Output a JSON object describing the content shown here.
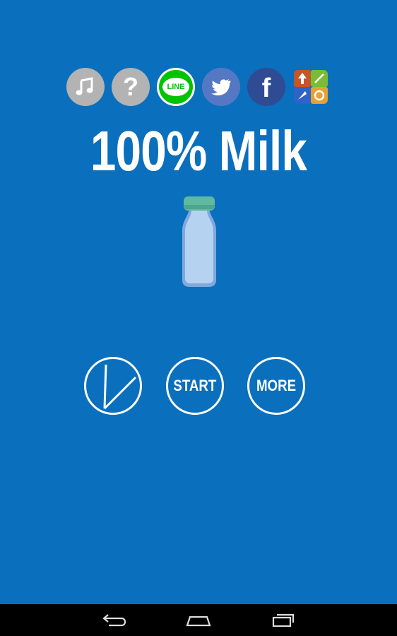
{
  "app": {
    "title": "100% Milk"
  },
  "top_icons": [
    {
      "name": "music-icon",
      "color": "#b3b3b3"
    },
    {
      "name": "help-icon",
      "color": "#b3b3b3",
      "glyph": "?"
    },
    {
      "name": "line-icon",
      "color": "#00c300",
      "label": "LINE"
    },
    {
      "name": "twitter-icon",
      "color": "#5578c4"
    },
    {
      "name": "facebook-icon",
      "color": "#2f4b93",
      "glyph": "f"
    },
    {
      "name": "more-games-icon",
      "color": "#e08a2c"
    }
  ],
  "buttons": {
    "ranking_icon": "slash-gauge-icon",
    "start_label": "START",
    "more_label": "MORE"
  },
  "colors": {
    "background": "#0a6fbd",
    "bottle_body": "#a9c8ee",
    "bottle_cap": "#5fb9a0",
    "button_border": "#ffffff",
    "nav_bar": "#000000"
  },
  "nav": {
    "items": [
      "back-icon",
      "home-icon",
      "recent-apps-icon"
    ]
  }
}
